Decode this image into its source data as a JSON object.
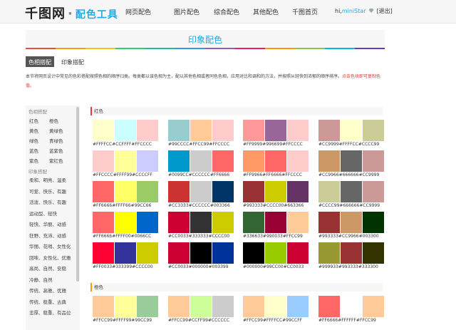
{
  "topbar": {
    "logo": "千图网",
    "logo_sub": "配色工具",
    "nav": [
      "网页配色",
      "图片配色",
      "综合配色",
      "其他配色",
      "千图首页"
    ],
    "user_prefix": "hi,",
    "user_name": "miniStar",
    "logout": "[退出]"
  },
  "banner": {
    "title": "印象配色"
  },
  "stripe_colors": [
    "#e74c3c",
    "#f39c12",
    "#f1c40f",
    "#2ecc71",
    "#1abc9c",
    "#3498db",
    "#9b59b6",
    "#e91e63",
    "#ff9800",
    "#8bc34a",
    "#00bcd4",
    "#673ab7"
  ],
  "tabs": [
    {
      "label": "色相搭配"
    },
    {
      "label": "印象搭配"
    }
  ],
  "desc": {
    "text": "本节将网页设计中常见的色彩搭配按照色相的顺序归类。每类都以该色相为主，配以其他色相或者同色色相，应用对比和调和的方法，并按照从轻快到浓郁的顺序排序。",
    "red": "点击色块即可复制色值。"
  },
  "sidebar": {
    "hue_header": "色相搭配",
    "hue_rows": [
      [
        "红色",
        "橙色"
      ],
      [
        "黄色",
        "黄绿色"
      ],
      [
        "绿色",
        "青绿色"
      ],
      [
        "蓝色",
        "蓝紫色"
      ],
      [
        "紫色",
        "紫红色"
      ]
    ],
    "impression_header": "印象搭配",
    "impression_items": [
      "柔和、明亮、温柔",
      "可爱、快乐、有趣",
      "活泼、快乐、有趣",
      "运动型、轻快",
      "轻快、华丽、动感",
      "狂野、充沛、动感",
      "华丽、花哨、女性化",
      "回味、女性化、优雅",
      "高尚、自然、安稳",
      "冷静、自然",
      "传统、高雅、优雅",
      "传统、稳重、古典",
      "忠厚、稳重、有品位"
    ]
  },
  "sections": [
    {
      "title": "红色",
      "bar_color": "#e4393c",
      "palettes": [
        [
          "#FFFFCC",
          "#CCFFFF",
          "#FFCCCC"
        ],
        [
          "#99CCCC",
          "#FFCC99",
          "#FFCCCC"
        ],
        [
          "#FF9999",
          "#996699",
          "#FFCCCC"
        ],
        [
          "#CC9999",
          "#FFFFCC",
          "#CCCC99"
        ],
        [
          "#FFCCCC",
          "#FFFF99",
          "#CCCCFF"
        ],
        [
          "#0099CC",
          "#CCCCCC",
          "#FF6666"
        ],
        [
          "#FF9966",
          "#FF6666",
          "#FFCCCC"
        ],
        [
          "#CC9966",
          "#666666",
          "#CC9999"
        ],
        [
          "#FF6666",
          "#FFFF66",
          "#99CC66"
        ],
        [
          "#CC3333",
          "#CCCCCC",
          "#003366"
        ],
        [
          "#993333",
          "#CCCC00",
          "#663366"
        ],
        [
          "#CCCC99",
          "#666666",
          "#CC9999"
        ],
        [
          "#FF6666",
          "#FFFF00",
          "#0066CC"
        ],
        [
          "#CC0033",
          "#333333",
          "#CCCC00"
        ],
        [
          "#336633",
          "#990033",
          "#FFCC99"
        ],
        [
          "#993333",
          "#CC9966",
          "#003300"
        ],
        [
          "#FF0033",
          "#333399",
          "#CCCC00"
        ],
        [
          "#CC0033",
          "#000000",
          "#003399"
        ],
        [
          "#000000",
          "#99CC00",
          "#CC0033"
        ],
        [
          "#999933",
          "#993333",
          "#333300"
        ]
      ]
    },
    {
      "title": "橙色",
      "bar_color": "#ff9900",
      "palettes": [
        [
          "#FFCC99",
          "#FFFF99",
          "#99CC99"
        ],
        [
          "#FFCC99",
          "#CCFF99",
          "#CCCCCC"
        ],
        [
          "#FFCC99",
          "#FFFFCC",
          "#99CCFF"
        ],
        [
          "#FF6666",
          "#FFFFFF",
          "#FFCC99"
        ]
      ]
    }
  ]
}
